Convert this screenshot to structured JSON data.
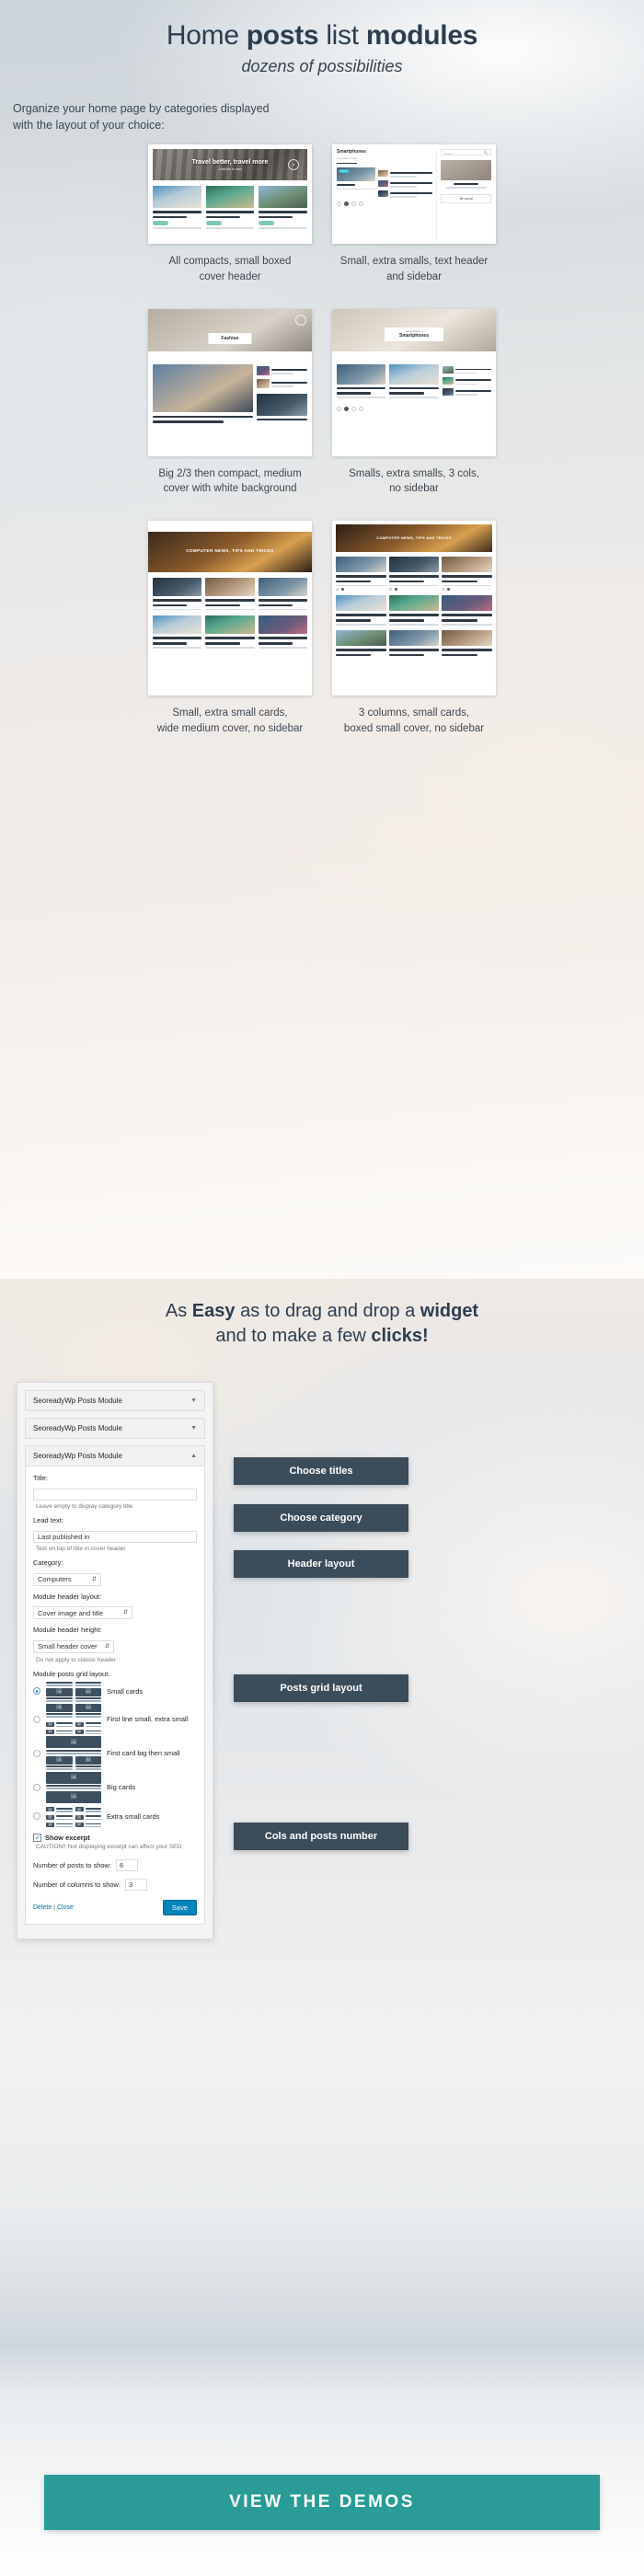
{
  "hero": {
    "title_part1": "Home ",
    "title_bold1": "posts",
    "title_part2": " list ",
    "title_bold2": "modules",
    "subtitle": "dozens of possibilities",
    "intro": "Organize your home page by categories displayed\nwith the layout of your choice:"
  },
  "layouts": [
    {
      "caption": "All compacts, small boxed\ncover header",
      "cover_title": "Travel better, travel more",
      "cover_sub": "4 articles to read",
      "cards": [
        {
          "title": "How to Plan an European Vacation?",
          "tag": "Travel"
        },
        {
          "title": "Helicopter tour Big Island: Unique aerial tour",
          "tag": "Travel"
        },
        {
          "title": "Solo travel and what it means for you",
          "tag": "Travel"
        }
      ]
    },
    {
      "caption": "Small, extra smalls, text header\nand sidebar",
      "header_title": "Smartphones",
      "header_sub": "5 articles to read",
      "search_placeholder": "Search...",
      "sidebar_title": "WordPress blog magazine",
      "sidebar_button": "Be social",
      "badge": "Promo",
      "cards": [
        {
          "title": "Huawei Honor 10Mhz Glance V9 Huawei 64GB by eMax"
        },
        {
          "title": "Best messaging apps in 2020 for your smartphone"
        },
        {
          "title": "How best smartphones can change your life"
        },
        {
          "title": "Top five smartphone tips tricks"
        }
      ]
    },
    {
      "caption": "Big 2/3 then compact, medium\ncover with white background",
      "cover_label": "Fashion",
      "cards": [
        {
          "title": "Transitional Pieces to Update Your Wardrobe"
        },
        {
          "title": "Best Fashion Trends for week for Women"
        },
        {
          "title": "Shoes are an Essential Accessory for Style"
        }
      ]
    },
    {
      "caption": "Smalls, extra smalls, 3 cols,\nno sidebar",
      "cover_pre": "Last published in",
      "cover_title": "Smartphones",
      "cards": [
        {
          "title": "Huawei Honor 10Mhz Glance V9 Huawei 64GB by eMax"
        },
        {
          "title": "How best smartphones can make your life simpler?"
        },
        {
          "title": "5 apps for managing your smartphone"
        },
        {
          "title": "Top tips for your mobile device"
        }
      ]
    },
    {
      "caption": "Small, extra small cards,\nwide medium cover, no sidebar",
      "cover_title": "COMPUTER NEWS, TIPS AND TRICKS",
      "cards": [
        {
          "title": "Computer writing ideas computer interesting"
        },
        {
          "title": "Blogging importance of computer training"
        },
        {
          "title": "Good web design tips & better use"
        },
        {
          "title": "Changes in problems that computer solve"
        },
        {
          "title": "What do the people use cheap PC to buy?"
        },
        {
          "title": "The new computer and design you build"
        }
      ]
    },
    {
      "caption": "3 columns, small cards,\nboxed small cover, no sidebar",
      "cover_title": "COMPUTER NEWS, TIPS AND TRICKS",
      "cards": [
        {
          "title": "Computer writing ideas computer interesting"
        },
        {
          "title": "Blogging importance of computer training"
        },
        {
          "title": "Good web design tips & better use"
        },
        {
          "title": "Changes in problems that computer solve"
        },
        {
          "title": "What do the people use cheap PC to buy?"
        },
        {
          "title": "The new computer and design you build"
        }
      ]
    }
  ],
  "section2": {
    "title_line1_a": "As ",
    "title_line1_b": "Easy",
    "title_line1_c": " as to drag and drop a ",
    "title_line1_d": "widget",
    "title_line2_a": "and to make a few ",
    "title_line2_b": "clicks!"
  },
  "widget": {
    "bar1_label": "SeoreadyWp Posts Module",
    "bar2_label": "SeoreadyWp Posts Module",
    "bar3_label": "SeoreadyWp Posts Module",
    "title_label": "Title:",
    "title_value": "",
    "title_hint": "Leave empty to display category title",
    "lead_label": "Lead text:",
    "lead_value": "Last published in",
    "lead_hint": "Text on top of title in cover header",
    "category_label": "Category:",
    "category_value": "Computers",
    "header_layout_label": "Module header layout:",
    "header_layout_value": "Cover image and title",
    "header_height_label": "Module header height:",
    "header_height_value": "Small header cover",
    "header_height_hint": "Do not apply to classic header",
    "grid_layout_label": "Module posts grid layout:",
    "grid_options": [
      {
        "label": "Small cards",
        "selected": true
      },
      {
        "label": "First line small, extra small",
        "selected": false
      },
      {
        "label": "First card big then small",
        "selected": false
      },
      {
        "label": "Big cards",
        "selected": false
      },
      {
        "label": "Extra small cards",
        "selected": false
      }
    ],
    "show_excerpt_label": "Show excerpt",
    "show_excerpt_checked": true,
    "caution": "CAUTION!! Not displaying excerpt can affect your SEO",
    "posts_label": "Number of posts to show:",
    "posts_value": "6",
    "cols_label": "Number of columns to show:",
    "cols_value": "3",
    "delete_label": "Delete",
    "close_label": "Close",
    "save_label": "Save"
  },
  "callouts": [
    {
      "label": "Choose titles"
    },
    {
      "label": "Choose category"
    },
    {
      "label": "Header layout"
    },
    {
      "label": "Posts grid layout"
    },
    {
      "label": "Cols and posts number"
    }
  ],
  "cta": {
    "label": "VIEW THE DEMOS"
  },
  "colors": {
    "accent": "#2a9b96",
    "dark": "#2c3e50",
    "callout": "#3b4c5a",
    "save": "#0085ba"
  }
}
